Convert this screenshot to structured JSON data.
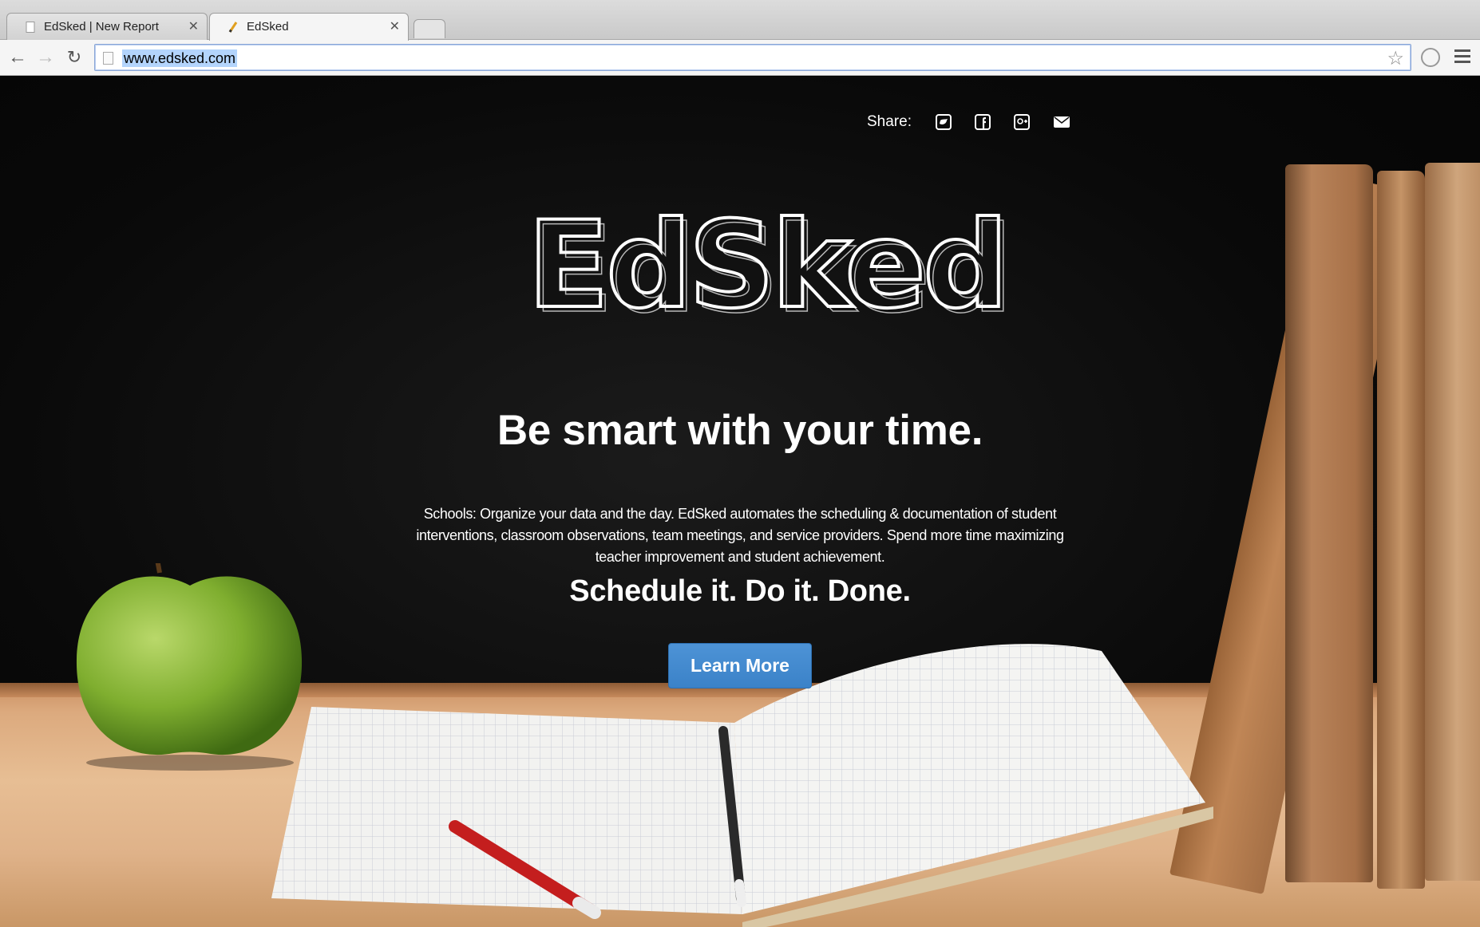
{
  "browser": {
    "tabs": [
      {
        "title": "EdSked | New Report",
        "active": false
      },
      {
        "title": "EdSked",
        "active": true
      }
    ],
    "address_bar": {
      "url": "www.edsked.com"
    },
    "icons": {
      "back": "arrow-left-icon",
      "forward": "arrow-right-icon",
      "reload": "reload-icon",
      "bookmark": "star-icon",
      "extension": "extension-icon",
      "menu": "hamburger-menu-icon"
    }
  },
  "page": {
    "share": {
      "label": "Share:",
      "icons": [
        "twitter-icon",
        "facebook-icon",
        "google-plus-icon",
        "email-icon"
      ]
    },
    "logo_text": "EdSked",
    "headline": "Be smart with your time.",
    "description": "Schools: Organize your data and the day. EdSked automates the scheduling & documentation of student interventions, classroom observations, team meetings, and service providers. Spend more time maximizing teacher improvement and student achievement.",
    "tagline": "Schedule it. Do it. Done.",
    "cta_label": "Learn More"
  },
  "colors": {
    "cta_background": "#3f87cc",
    "background": "#0a0a0a",
    "text": "#ffffff"
  }
}
